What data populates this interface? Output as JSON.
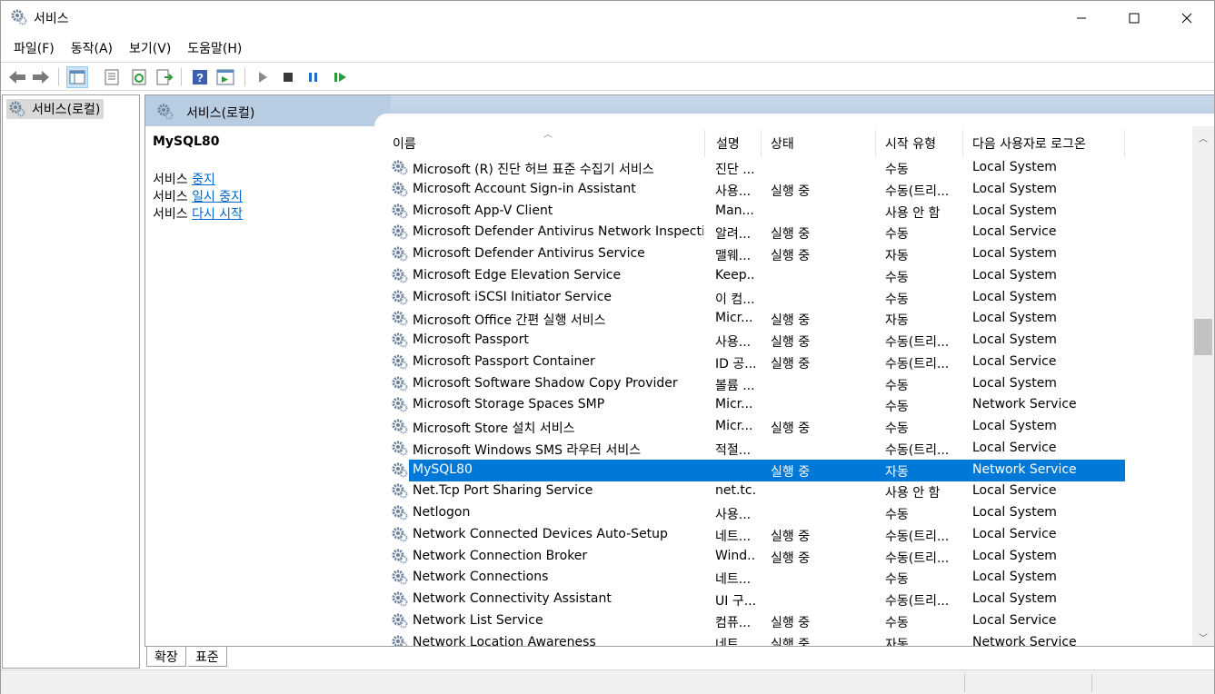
{
  "window": {
    "title": "서비스"
  },
  "menu": {
    "items": [
      "파일(F)",
      "동작(A)",
      "보기(V)",
      "도움말(H)"
    ]
  },
  "tree": {
    "root_label": "서비스(로컬)"
  },
  "pane_header": {
    "title": "서비스(로컬)"
  },
  "description": {
    "service_name": "MySQL80",
    "actions": [
      {
        "prefix": "서비스 ",
        "link": "중지"
      },
      {
        "prefix": "서비스 ",
        "link": "일시 중지"
      },
      {
        "prefix": "서비스 ",
        "link": "다시 시작"
      }
    ]
  },
  "columns": {
    "name": "이름",
    "description": "설명",
    "status": "상태",
    "startup_type": "시작 유형",
    "logon_as": "다음 사용자로 로그온"
  },
  "services": [
    {
      "name": "Microsoft (R) 진단 허브 표준 수집기 서비스",
      "desc": "진단 ...",
      "status": "",
      "start": "수동",
      "logon": "Local System"
    },
    {
      "name": "Microsoft Account Sign-in Assistant",
      "desc": "사용...",
      "status": "실행 중",
      "start": "수동(트리...",
      "logon": "Local System"
    },
    {
      "name": "Microsoft App-V Client",
      "desc": "Man...",
      "status": "",
      "start": "사용 안 함",
      "logon": "Local System"
    },
    {
      "name": "Microsoft Defender Antivirus Network Inspecti...",
      "desc": "알려...",
      "status": "실행 중",
      "start": "수동",
      "logon": "Local Service"
    },
    {
      "name": "Microsoft Defender Antivirus Service",
      "desc": "맬웨...",
      "status": "실행 중",
      "start": "자동",
      "logon": "Local System"
    },
    {
      "name": "Microsoft Edge Elevation Service",
      "desc": "Keep...",
      "status": "",
      "start": "수동",
      "logon": "Local System"
    },
    {
      "name": "Microsoft iSCSI Initiator Service",
      "desc": "이 컴...",
      "status": "",
      "start": "수동",
      "logon": "Local System"
    },
    {
      "name": "Microsoft Office 간편 실행 서비스",
      "desc": "Micr...",
      "status": "실행 중",
      "start": "자동",
      "logon": "Local System"
    },
    {
      "name": "Microsoft Passport",
      "desc": "사용...",
      "status": "실행 중",
      "start": "수동(트리...",
      "logon": "Local System"
    },
    {
      "name": "Microsoft Passport Container",
      "desc": "ID 공...",
      "status": "실행 중",
      "start": "수동(트리...",
      "logon": "Local Service"
    },
    {
      "name": "Microsoft Software Shadow Copy Provider",
      "desc": "볼륨 ...",
      "status": "",
      "start": "수동",
      "logon": "Local System"
    },
    {
      "name": "Microsoft Storage Spaces SMP",
      "desc": "Micr...",
      "status": "",
      "start": "수동",
      "logon": "Network Service"
    },
    {
      "name": "Microsoft Store 설치 서비스",
      "desc": "Micr...",
      "status": "실행 중",
      "start": "수동",
      "logon": "Local System"
    },
    {
      "name": "Microsoft Windows SMS 라우터 서비스",
      "desc": "적절...",
      "status": "",
      "start": "수동(트리...",
      "logon": "Local Service"
    },
    {
      "name": "MySQL80",
      "desc": "",
      "status": "실행 중",
      "start": "자동",
      "logon": "Network Service",
      "selected": true
    },
    {
      "name": "Net.Tcp Port Sharing Service",
      "desc": "net.tc...",
      "status": "",
      "start": "사용 안 함",
      "logon": "Local Service"
    },
    {
      "name": "Netlogon",
      "desc": "사용...",
      "status": "",
      "start": "수동",
      "logon": "Local System"
    },
    {
      "name": "Network Connected Devices Auto-Setup",
      "desc": "네트...",
      "status": "실행 중",
      "start": "수동(트리...",
      "logon": "Local Service"
    },
    {
      "name": "Network Connection Broker",
      "desc": "Wind...",
      "status": "실행 중",
      "start": "수동(트리...",
      "logon": "Local System"
    },
    {
      "name": "Network Connections",
      "desc": "네트...",
      "status": "",
      "start": "수동",
      "logon": "Local System"
    },
    {
      "name": "Network Connectivity Assistant",
      "desc": "UI 구...",
      "status": "",
      "start": "수동(트리...",
      "logon": "Local System"
    },
    {
      "name": "Network List Service",
      "desc": "컴퓨...",
      "status": "실행 중",
      "start": "수동",
      "logon": "Local Service"
    },
    {
      "name": "Network Location Awareness",
      "desc": "네트...",
      "status": "실행 중",
      "start": "자동",
      "logon": "Network Service"
    }
  ],
  "tabs": {
    "extended": "확장",
    "standard": "표준"
  },
  "colors": {
    "selection": "#0078d7",
    "header": "#b8cde1",
    "link": "#0066cc"
  },
  "icons": [
    "gear-icon",
    "back-arrow-icon",
    "forward-arrow-icon",
    "console-tree-icon",
    "properties-icon",
    "refresh-icon",
    "export-icon",
    "help-icon",
    "view-icon",
    "play-icon",
    "stop-icon",
    "pause-icon",
    "resume-icon"
  ]
}
